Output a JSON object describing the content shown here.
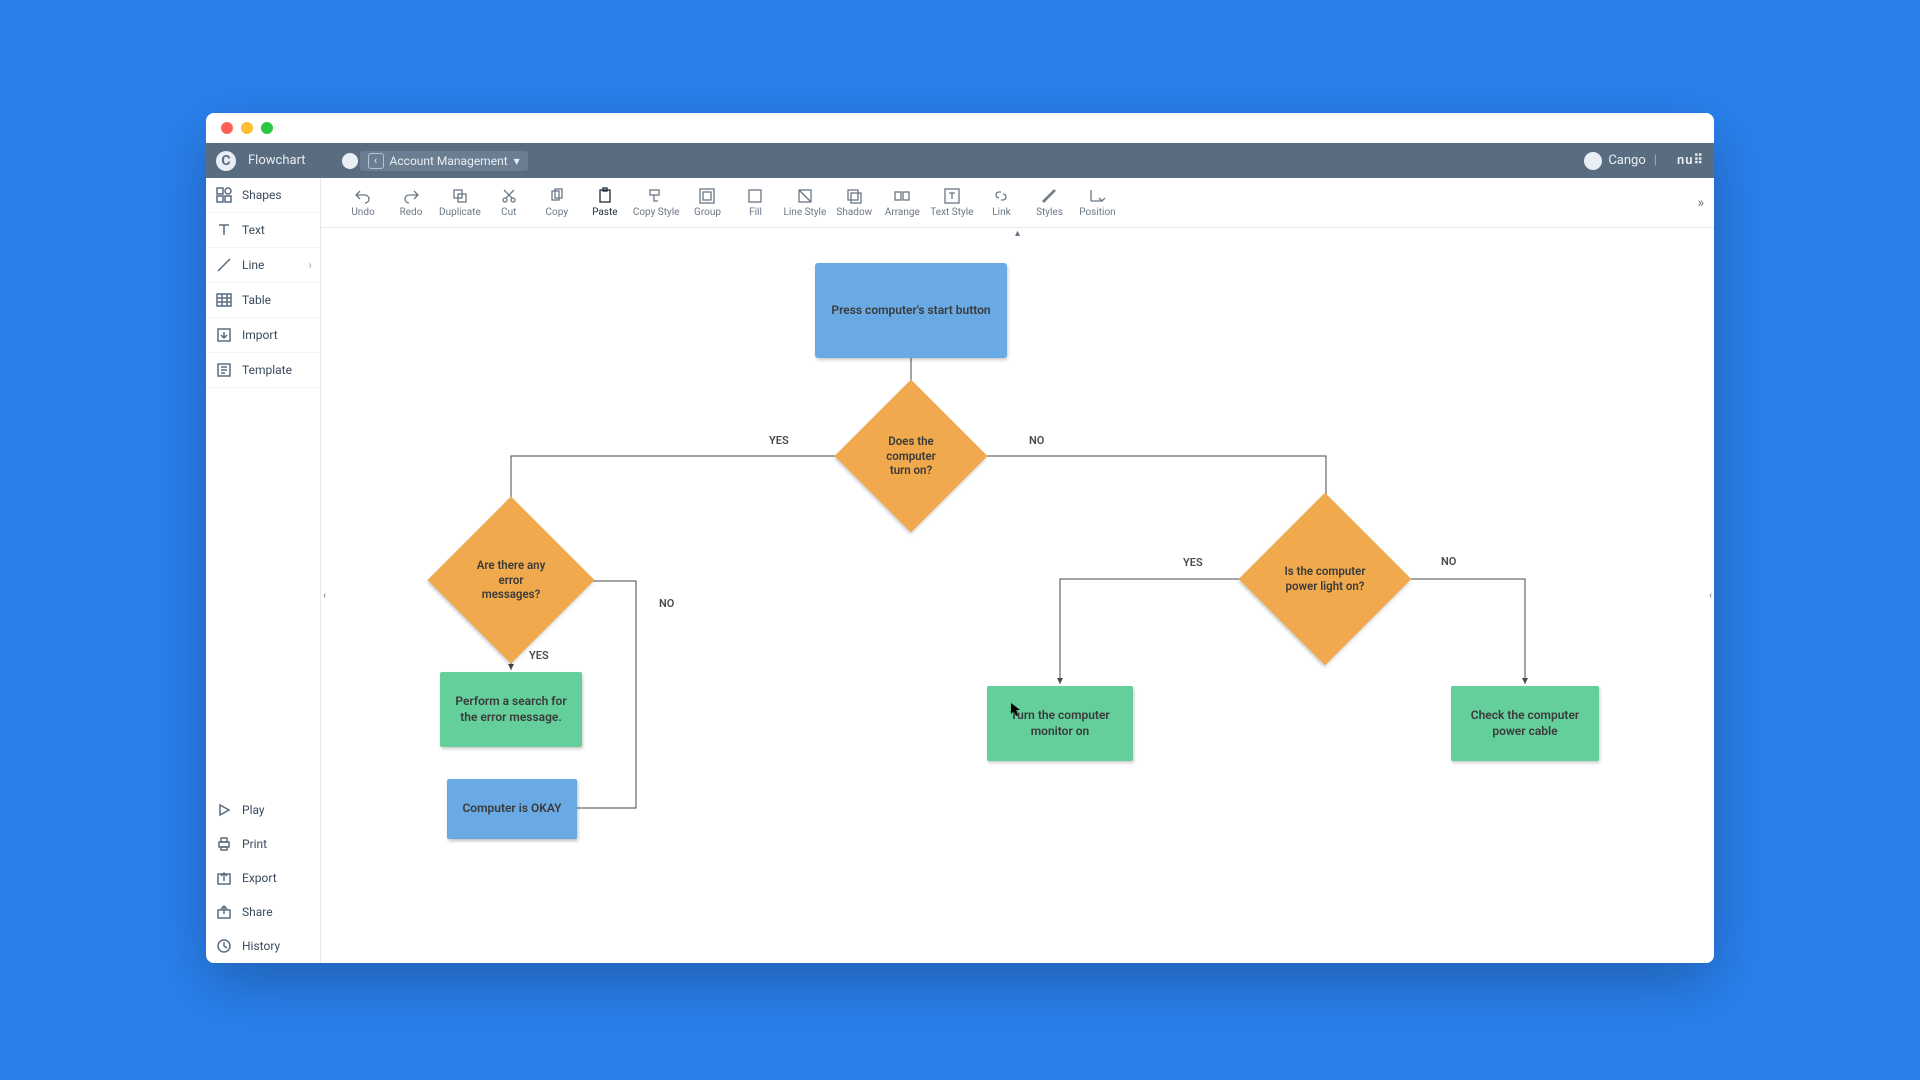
{
  "window": {
    "app_title": "Flowchart",
    "document_name": "Account Management",
    "user_name": "Cango",
    "brand": "nu⠿"
  },
  "sidebar": {
    "top": [
      {
        "label": "Shapes"
      },
      {
        "label": "Text"
      },
      {
        "label": "Line"
      },
      {
        "label": "Table"
      },
      {
        "label": "Import"
      },
      {
        "label": "Template"
      }
    ],
    "bottom": [
      {
        "label": "Play"
      },
      {
        "label": "Print"
      },
      {
        "label": "Export"
      },
      {
        "label": "Share"
      },
      {
        "label": "History"
      }
    ]
  },
  "toolbar": {
    "items": [
      {
        "label": "Undo"
      },
      {
        "label": "Redo"
      },
      {
        "label": "Duplicate"
      },
      {
        "label": "Cut"
      },
      {
        "label": "Copy"
      },
      {
        "label": "Paste",
        "active": true
      },
      {
        "label": "Copy Style"
      },
      {
        "label": "Group"
      },
      {
        "label": "Fill"
      },
      {
        "label": "Line Style"
      },
      {
        "label": "Shadow"
      },
      {
        "label": "Arrange"
      },
      {
        "label": "Text Style"
      },
      {
        "label": "Link"
      },
      {
        "label": "Styles"
      },
      {
        "label": "Position"
      }
    ],
    "more": "»"
  },
  "flow": {
    "n_start": "Press computer's start button",
    "n_turn_on": "Does the computer turn on?",
    "n_errors": "Are there any error messages?",
    "n_power_light": "Is the computer power light on?",
    "n_search": "Perform a search for the error message.",
    "n_monitor": "Turn the computer monitor on",
    "n_cable": "Check the computer power cable",
    "n_ok": "Computer is OKAY",
    "yes1": "YES",
    "no1": "NO",
    "yes2": "YES",
    "no2": "NO",
    "yes3": "YES",
    "no3": "NO"
  },
  "chart_data": {
    "type": "flowchart",
    "nodes": [
      {
        "id": "start",
        "text": "Press computer's start button",
        "shape": "process",
        "color": "#6aaae4"
      },
      {
        "id": "turn_on",
        "text": "Does the computer turn on?",
        "shape": "decision",
        "color": "#f0a94d"
      },
      {
        "id": "errors",
        "text": "Are there any error messages?",
        "shape": "decision",
        "color": "#f0a94d"
      },
      {
        "id": "power_light",
        "text": "Is the computer power light on?",
        "shape": "decision",
        "color": "#f0a94d"
      },
      {
        "id": "search",
        "text": "Perform a search for the error message.",
        "shape": "process",
        "color": "#65cf9b"
      },
      {
        "id": "monitor",
        "text": "Turn the computer monitor on",
        "shape": "process",
        "color": "#65cf9b"
      },
      {
        "id": "cable",
        "text": "Check the computer power cable",
        "shape": "process",
        "color": "#65cf9b"
      },
      {
        "id": "ok",
        "text": "Computer is OKAY",
        "shape": "process",
        "color": "#6aaae4"
      }
    ],
    "edges": [
      {
        "from": "start",
        "to": "turn_on"
      },
      {
        "from": "turn_on",
        "to": "errors",
        "label": "YES"
      },
      {
        "from": "turn_on",
        "to": "power_light",
        "label": "NO"
      },
      {
        "from": "errors",
        "to": "search",
        "label": "YES"
      },
      {
        "from": "errors",
        "to": "ok",
        "label": "NO"
      },
      {
        "from": "power_light",
        "to": "monitor",
        "label": "YES"
      },
      {
        "from": "power_light",
        "to": "cable",
        "label": "NO"
      }
    ]
  }
}
